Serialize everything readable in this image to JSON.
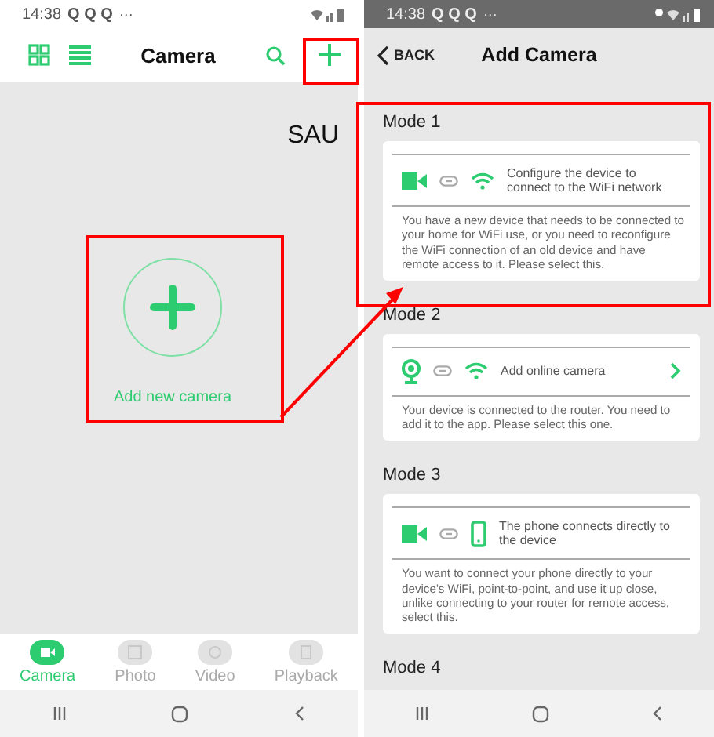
{
  "left_screen": {
    "status_bar": {
      "time": "14:38",
      "notifications": "Q Q Q",
      "more": "···"
    },
    "header": {
      "title": "Camera"
    },
    "body": {
      "label": "SAU",
      "add_button": {
        "label": "Add new camera"
      }
    },
    "tabs": [
      {
        "kind": "camera",
        "label": "Camera",
        "selected": true
      },
      {
        "kind": "photo",
        "label": "Photo",
        "selected": false
      },
      {
        "kind": "video",
        "label": "Video",
        "selected": false
      },
      {
        "kind": "playback",
        "label": "Playback",
        "selected": false
      }
    ]
  },
  "right_screen": {
    "status_bar": {
      "time": "14:38",
      "notifications": "Q Q Q",
      "more": "···"
    },
    "header": {
      "back": "BACK",
      "title": "Add Camera"
    },
    "modes": [
      {
        "title": "Mode 1",
        "kind": "wifi",
        "summary": "Configure the device to connect to the WiFi network",
        "arrow": false,
        "description": "You have a new device that needs to be connected to your home for WiFi use, or you need to reconfigure the WiFi connection of an old device and have remote access to it. Please select this."
      },
      {
        "title": "Mode 2",
        "kind": "online",
        "summary": "Add online camera",
        "arrow": true,
        "description": "Your device is connected to the router. You need to add it to the app. Please select this one."
      },
      {
        "title": "Mode 3",
        "kind": "direct",
        "summary": "The phone connects directly to the device",
        "arrow": false,
        "description": "You want to connect your phone directly to your device's WiFi, point-to-point, and use it up close, unlike connecting to your router for remote access, select this."
      },
      {
        "title": "Mode 4"
      }
    ]
  }
}
